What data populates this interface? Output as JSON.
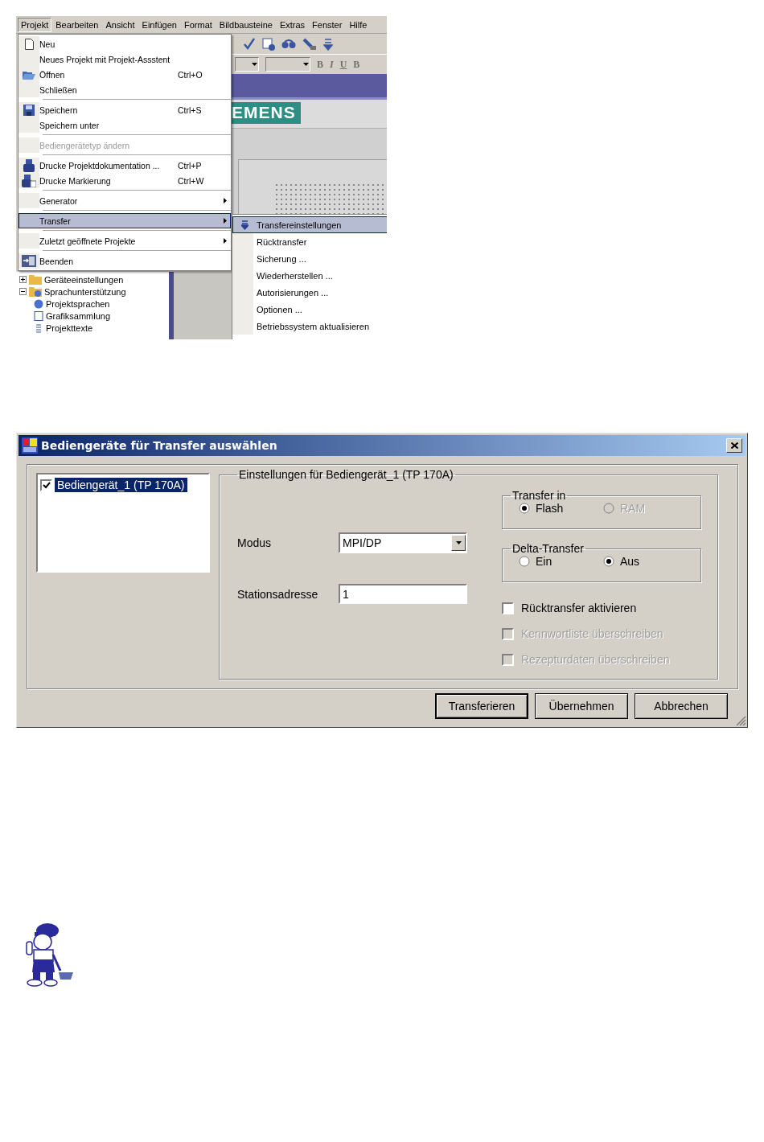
{
  "screenshot": {
    "menu_bar": [
      {
        "label": "Projekt",
        "selected": true
      },
      {
        "label": "Bearbeiten",
        "selected": false
      },
      {
        "label": "Ansicht",
        "selected": false
      },
      {
        "label": "Einfügen",
        "selected": false
      },
      {
        "label": "Format",
        "selected": false
      },
      {
        "label": "Bildbausteine",
        "selected": false
      },
      {
        "label": "Extras",
        "selected": false
      },
      {
        "label": "Fenster",
        "selected": false
      },
      {
        "label": "Hilfe",
        "selected": false
      }
    ],
    "format_buttons": [
      "B",
      "I",
      "U",
      "B"
    ],
    "brand": "EMENS",
    "menu": {
      "groups": [
        {
          "items": [
            {
              "label": "Neu",
              "disabled": false,
              "selected": false,
              "has_submenu": false
            },
            {
              "label": "Neues Projekt mit Projekt-Assstent",
              "disabled": false,
              "selected": false,
              "has_submenu": false
            },
            {
              "label": "Öffnen",
              "shortcut": "Ctrl+O",
              "disabled": false,
              "selected": false,
              "has_submenu": false
            },
            {
              "label": "Schließen",
              "disabled": false,
              "selected": false,
              "has_submenu": false
            }
          ]
        },
        {
          "items": [
            {
              "label": "Speichern",
              "shortcut": "Ctrl+S",
              "disabled": false,
              "selected": false,
              "has_submenu": false
            },
            {
              "label": "Speichern unter",
              "disabled": false,
              "selected": false,
              "has_submenu": false
            }
          ]
        },
        {
          "items": [
            {
              "label": "Bediengerätetyp ändern",
              "disabled": true,
              "selected": false,
              "has_submenu": false
            }
          ]
        },
        {
          "items": [
            {
              "label": "Drucke Projektdokumentation ...",
              "shortcut": "Ctrl+P",
              "disabled": false,
              "selected": false,
              "has_submenu": false
            },
            {
              "label": "Drucke Markierung",
              "shortcut": "Ctrl+W",
              "disabled": false,
              "selected": false,
              "has_submenu": false
            }
          ]
        },
        {
          "items": [
            {
              "label": "Generator",
              "disabled": false,
              "selected": false,
              "has_submenu": true
            }
          ]
        },
        {
          "items": [
            {
              "label": "Transfer",
              "disabled": false,
              "selected": true,
              "has_submenu": true
            }
          ]
        },
        {
          "items": [
            {
              "label": "Zuletzt geöffnete Projekte",
              "disabled": false,
              "selected": false,
              "has_submenu": true
            }
          ]
        },
        {
          "items": [
            {
              "label": "Beenden",
              "disabled": false,
              "selected": false,
              "has_submenu": false
            }
          ]
        }
      ]
    },
    "submenu": [
      {
        "label": "Transfereinstellungen",
        "selected": true
      },
      {
        "label": "Rücktransfer",
        "selected": false
      },
      {
        "label": "Sicherung ...",
        "selected": false
      },
      {
        "label": "Wiederherstellen ...",
        "selected": false
      },
      {
        "label": "Autorisierungen ...",
        "selected": false
      },
      {
        "label": "Optionen ...",
        "selected": false
      },
      {
        "label": "Betriebssystem aktualisieren",
        "selected": false
      }
    ],
    "tree": [
      {
        "label": "Geräteeinstellungen",
        "expanded": false
      },
      {
        "label": "Sprachunterstützung",
        "expanded": true,
        "children": [
          {
            "label": "Projektsprachen"
          },
          {
            "label": "Grafiksammlung"
          },
          {
            "label": "Projekttexte"
          }
        ]
      }
    ]
  },
  "dialog": {
    "title": "Bediengeräte für Transfer auswählen",
    "devices": [
      {
        "label": "Bediengerät_1 (TP 170A)",
        "checked": true,
        "selected": true
      }
    ],
    "settings": {
      "title": "Einstellungen für Bediengerät_1 (TP 170A)",
      "mode": {
        "label": "Modus",
        "value": "MPI/DP"
      },
      "station": {
        "label": "Stationsadresse",
        "value": "1"
      },
      "groups": [
        {
          "title": "Transfer in",
          "options": [
            {
              "label": "Flash",
              "selected": true,
              "disabled": false
            },
            {
              "label": "RAM",
              "selected": false,
              "disabled": true
            }
          ]
        },
        {
          "title": "Delta-Transfer",
          "options": [
            {
              "label": "Ein",
              "selected": false,
              "disabled": false
            },
            {
              "label": "Aus",
              "selected": true,
              "disabled": false
            }
          ]
        }
      ],
      "checkboxes": [
        {
          "label": "Rücktransfer aktivieren",
          "checked": false,
          "disabled": false
        },
        {
          "label": "Kennwortliste überschreiben",
          "checked": false,
          "disabled": true
        },
        {
          "label": "Rezepturdaten überschreiben",
          "checked": false,
          "disabled": true
        }
      ]
    },
    "buttons": [
      {
        "label": "Transferieren",
        "default": true
      },
      {
        "label": "Übernehmen",
        "default": false
      },
      {
        "label": "Abbrechen",
        "default": false
      }
    ]
  }
}
